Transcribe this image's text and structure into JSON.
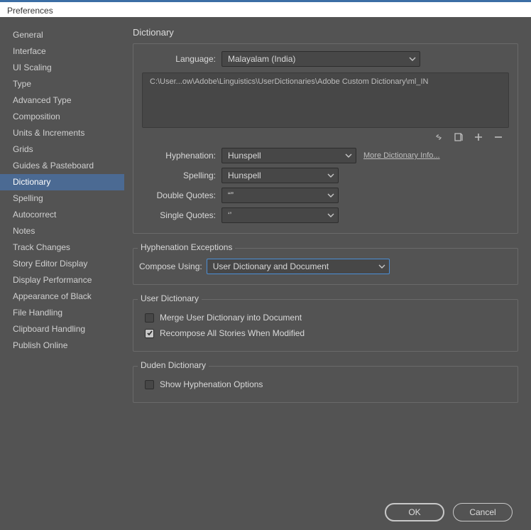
{
  "window": {
    "title": "Preferences"
  },
  "sidebar": {
    "items": [
      {
        "label": "General"
      },
      {
        "label": "Interface"
      },
      {
        "label": "UI Scaling"
      },
      {
        "label": "Type"
      },
      {
        "label": "Advanced Type"
      },
      {
        "label": "Composition"
      },
      {
        "label": "Units & Increments"
      },
      {
        "label": "Grids"
      },
      {
        "label": "Guides & Pasteboard"
      },
      {
        "label": "Dictionary"
      },
      {
        "label": "Spelling"
      },
      {
        "label": "Autocorrect"
      },
      {
        "label": "Notes"
      },
      {
        "label": "Track Changes"
      },
      {
        "label": "Story Editor Display"
      },
      {
        "label": "Display Performance"
      },
      {
        "label": "Appearance of Black"
      },
      {
        "label": "File Handling"
      },
      {
        "label": "Clipboard Handling"
      },
      {
        "label": "Publish Online"
      }
    ],
    "active_index": 9
  },
  "page": {
    "title": "Dictionary",
    "language": {
      "label": "Language:",
      "value": "Malayalam (India)"
    },
    "path": "C:\\User...ow\\Adobe\\Linguistics\\UserDictionaries\\Adobe Custom Dictionary\\ml_IN",
    "hyphenation": {
      "label": "Hyphenation:",
      "value": "Hunspell"
    },
    "more_info": "More Dictionary Info...",
    "spelling": {
      "label": "Spelling:",
      "value": "Hunspell"
    },
    "double_quotes": {
      "label": "Double Quotes:",
      "value": "“”"
    },
    "single_quotes": {
      "label": "Single Quotes:",
      "value": "‘’"
    },
    "hyph_exceptions": {
      "legend": "Hyphenation Exceptions",
      "compose_label": "Compose Using:",
      "compose_value": "User Dictionary and Document"
    },
    "user_dict": {
      "legend": "User Dictionary",
      "merge_label": "Merge User Dictionary into Document",
      "merge_checked": false,
      "recompose_label": "Recompose All Stories When Modified",
      "recompose_checked": true
    },
    "duden": {
      "legend": "Duden Dictionary",
      "show_label": "Show Hyphenation Options",
      "show_checked": false
    }
  },
  "footer": {
    "ok": "OK",
    "cancel": "Cancel"
  }
}
